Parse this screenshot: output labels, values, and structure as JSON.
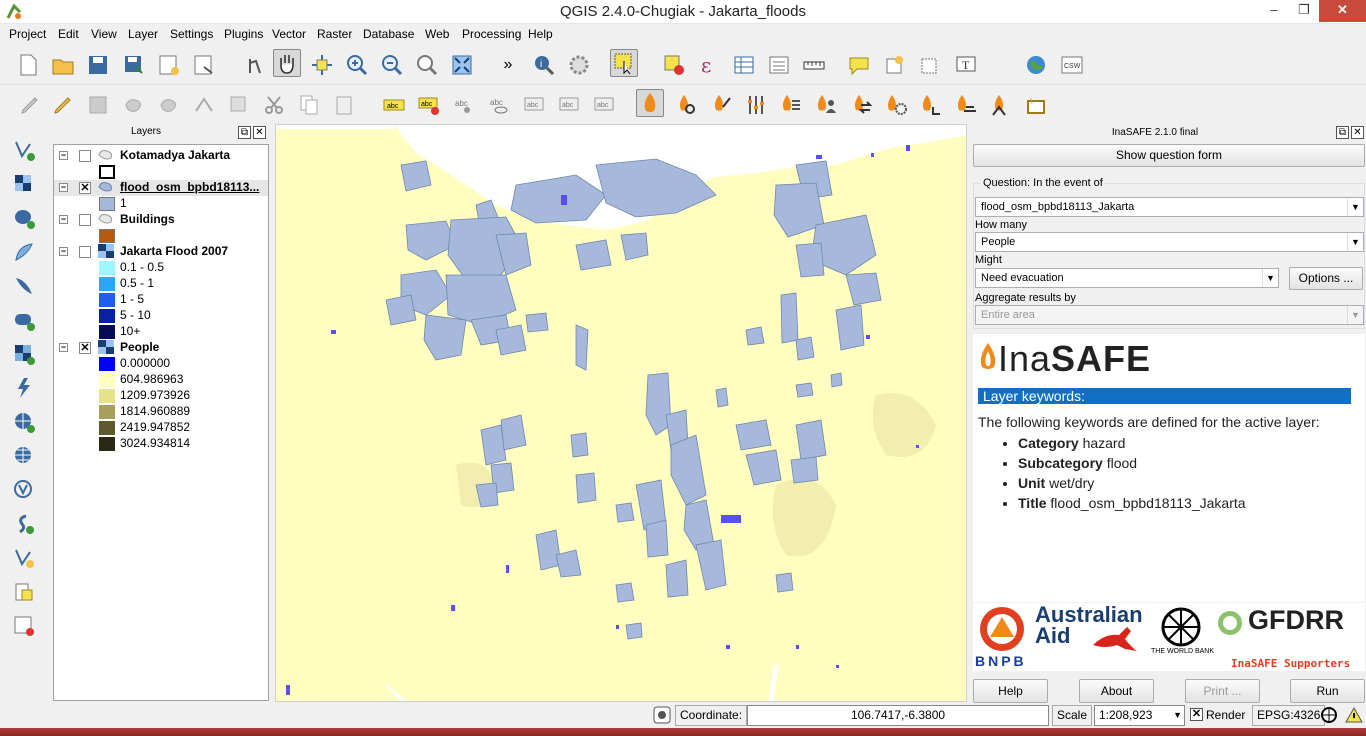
{
  "window": {
    "title": "QGIS 2.4.0-Chugiak - Jakarta_floods",
    "minimize": "–",
    "maximize": "❐",
    "close": "✕"
  },
  "menu": [
    "Project",
    "Edit",
    "View",
    "Layer",
    "Settings",
    "Plugins",
    "Vector",
    "Raster",
    "Database",
    "Web",
    "Processing",
    "Help"
  ],
  "toolbar_overflow": "»",
  "layers_panel": {
    "title": "Layers",
    "layers": [
      {
        "name": "Kotamadya Jakarta",
        "checked": false,
        "legend": [
          {
            "label": "",
            "color": "#ffffff"
          }
        ]
      },
      {
        "name": "flood_osm_bpbd18113...",
        "checked": true,
        "legend": [
          {
            "label": "1",
            "color": "#a6b9da"
          }
        ]
      },
      {
        "name": "Buildings",
        "checked": false,
        "legend": [
          {
            "label": "",
            "color": "#b55a0b"
          }
        ]
      },
      {
        "name": "Jakarta Flood 2007",
        "checked": false,
        "legend": [
          {
            "label": "0.1 - 0.5",
            "color": "#9ef7ff"
          },
          {
            "label": "0.5 - 1",
            "color": "#27a8ff"
          },
          {
            "label": "1 - 5",
            "color": "#1e5cf2"
          },
          {
            "label": "5 - 10",
            "color": "#0a1fa6"
          },
          {
            "label": "10+",
            "color": "#050b55"
          }
        ]
      },
      {
        "name": "People",
        "checked": true,
        "legend": [
          {
            "label": "0.000000",
            "color": "#0000ff"
          },
          {
            "label": "604.986963",
            "color": "#ffffc0"
          },
          {
            "label": "1209.973926",
            "color": "#e6e28a"
          },
          {
            "label": "1814.960889",
            "color": "#a8a05a"
          },
          {
            "label": "2419.947852",
            "color": "#5c5a2e"
          },
          {
            "label": "3024.934814",
            "color": "#2a2a14"
          }
        ]
      }
    ]
  },
  "inasafe": {
    "title": "InaSAFE 2.1.0 final",
    "show_question_form": "Show question form",
    "question_label": "Question: In the event of",
    "hazard": "flood_osm_bpbd18113_Jakarta",
    "how_many_label": "How many",
    "exposure": "People",
    "might_label": "Might",
    "impact_function": "Need evacuation",
    "options_button": "Options ...",
    "aggregate_label": "Aggregate results by",
    "aggregation": "Entire area",
    "report": {
      "logo_prefix": "Ina",
      "logo_suffix": "SAFE",
      "heading": "Layer keywords:",
      "intro": "The following keywords are defined for the active layer:",
      "keywords": [
        {
          "key": "Category",
          "value": "hazard"
        },
        {
          "key": "Subcategory",
          "value": "flood"
        },
        {
          "key": "Unit",
          "value": "wet/dry"
        },
        {
          "key": "Title",
          "value": "flood_osm_bpbd18113_Jakarta"
        }
      ]
    },
    "supporters": {
      "bnpb": "BNPB",
      "australian_aid_1": "Australian",
      "australian_aid_2": "Aid",
      "world_bank": "THE WORLD BANK",
      "gfdrr": "GFDRR",
      "caption": "InaSAFE Supporters"
    },
    "buttons": {
      "help": "Help",
      "about": "About",
      "print": "Print ...",
      "run": "Run"
    }
  },
  "statusbar": {
    "coordinate_label": "Coordinate:",
    "coordinate": "106.7417,-6.3800",
    "scale_label": "Scale",
    "scale": "1:208,923",
    "render_label": "Render",
    "crs": "EPSG:4326"
  }
}
